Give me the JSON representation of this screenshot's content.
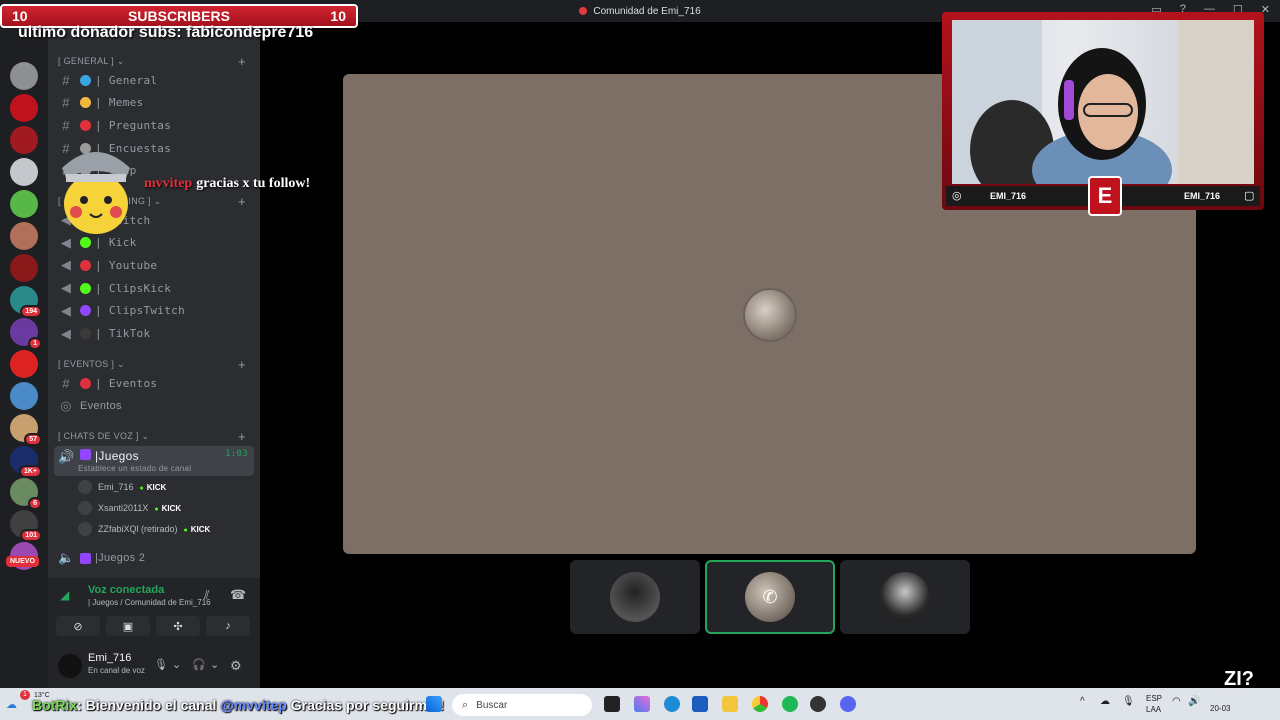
{
  "window": {
    "title": "Comunidad de Emi_716"
  },
  "overlay": {
    "subs_count_left": "10",
    "subs_label": "SUBSCRIBERS",
    "subs_count_right": "10",
    "donor_text": "ultimo donador subs: fabicondepre716",
    "follow_user": "mvvitep",
    "follow_msg": "gracias x tu follow!",
    "cam_name_left": "EMI_716",
    "cam_name_right": "EMI_716",
    "cam_logo": "E",
    "corner_badge": "ZI?"
  },
  "servers": [
    {
      "color": "#8e8f93",
      "badge": ""
    },
    {
      "color": "#c0121c",
      "badge": ""
    },
    {
      "color": "#a01a20",
      "badge": ""
    },
    {
      "color": "#c5c7cc",
      "badge": ""
    },
    {
      "color": "#57b848",
      "badge": ""
    },
    {
      "color": "#b0705a",
      "badge": ""
    },
    {
      "color": "#8a1a1a",
      "badge": ""
    },
    {
      "color": "#2a8a8a",
      "badge": "194"
    },
    {
      "color": "#6a3aa0",
      "badge": "1"
    },
    {
      "color": "#d22",
      "badge": ""
    },
    {
      "color": "#4a8ac8",
      "badge": ""
    },
    {
      "color": "#c8a070",
      "badge": "57"
    },
    {
      "color": "#1b2d6a",
      "badge": "1K+"
    },
    {
      "color": "#6a8a60",
      "badge": "6"
    },
    {
      "color": "#404040",
      "badge": "101"
    },
    {
      "color": "#9a4ab0",
      "badge": ""
    }
  ],
  "servers_nuevo": "NUEVO",
  "sidebar": {
    "server_name": "Comunidad de Emi_716",
    "categories": {
      "general": "[ GENERAL ] ⌄",
      "streaming": "[ C___ STREAMING ] ⌄",
      "eventos": "[ EVENTOS ] ⌄",
      "voz": "[ CHATS DE VOZ ] ⌄"
    },
    "text_channels": [
      {
        "label": "| General",
        "color": "#3ba5e0"
      },
      {
        "label": "| Memes",
        "color": "#f4b740"
      },
      {
        "label": "| Preguntas",
        "color": "#e0303c"
      },
      {
        "label": "| Encuestas",
        "color": "#9a9a9a"
      },
      {
        "label": "| Clip",
        "color": "#9a9a9a"
      }
    ],
    "stream_channels": [
      {
        "label": "| Twitch",
        "color": "#9146ff"
      },
      {
        "label": "| Kick",
        "color": "#53fc18"
      },
      {
        "label": "| Youtube",
        "color": "#e0303c"
      },
      {
        "label": "| ClipsKick",
        "color": "#53fc18"
      },
      {
        "label": "| ClipsTwitch",
        "color": "#9146ff"
      },
      {
        "label": "| TikTok",
        "color": "#3a3a3a"
      }
    ],
    "event_channels": [
      {
        "label": "| Eventos",
        "color": "#e0303c"
      }
    ],
    "events_link": "Eventos",
    "voice": {
      "channel": "|Juegos",
      "time": "1:03",
      "status_hint": "Establece un estado de canal",
      "users": [
        {
          "name": "Emi_716",
          "badge": "KICK"
        },
        {
          "name": "Xsanti2011X",
          "badge": "KICK"
        },
        {
          "name": "ZZfabiXQl (retirado)",
          "badge": "KICK"
        }
      ],
      "channel2": "|Juegos 2"
    }
  },
  "voice_panel": {
    "status": "Voz conectada",
    "location": "| Juegos / Comunidad de Emi_716",
    "user_name": "Emi_716",
    "user_status": "En canal de voz"
  },
  "taskbar": {
    "ticker_bot": "BotRix",
    "ticker_pre": ": Bienvenido el canal ",
    "ticker_user": "@mvvitep",
    "ticker_post": " Gracias por seguirme!!",
    "search_placeholder": "Buscar",
    "weather": "13°C",
    "lang": "ESP",
    "lang2": "LAA",
    "date": "20-03"
  },
  "colors": {
    "accent_green": "#23a55a",
    "brand_red": "#c0121c"
  }
}
